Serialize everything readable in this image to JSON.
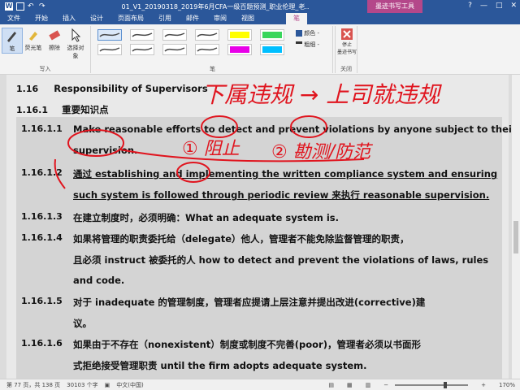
{
  "titlebar": {
    "doc_title": "01_V1_20190318_2019年6月CFA一级百题预测_职业伦理_老..",
    "context_tab": "墨迹书写工具"
  },
  "tabs": [
    "文件",
    "开始",
    "插入",
    "设计",
    "页面布局",
    "引用",
    "邮件",
    "审阅",
    "视图",
    "笔"
  ],
  "ribbon": {
    "tools": [
      "笔",
      "荧光笔",
      "擦除",
      "选择对象"
    ],
    "group_write": "写入",
    "group_pens": "笔",
    "color_label": "颜色 -",
    "thickness_label": "粗细 -",
    "stop_label": "停止\n墨迹书写",
    "group_close": "关闭",
    "pen_colors": [
      "#4a4a4a",
      "#4a4a4a",
      "#4a4a4a",
      "#4a4a4a",
      "#ffff00",
      "#39d65c",
      "#4a4a4a",
      "#4a4a4a",
      "#4a4a4a",
      "#4a4a4a",
      "#e800e8",
      "#00bfff"
    ]
  },
  "document": {
    "heading": {
      "num": "1.16",
      "text": "Responsibility of Supervisors"
    },
    "subheading": {
      "num": "1.16.1",
      "text": "重要知识点"
    },
    "items": [
      {
        "num": "1.16.1.1",
        "lines": [
          "Make reasonable efforts to detect and prevent violations by anyone subject to their",
          "supervision."
        ]
      },
      {
        "num": "1.16.1.2",
        "lines": [
          "通过 establishing and implementing the written compliance system and ensuring",
          "such system is followed through periodic review 来执行 reasonable supervision."
        ]
      },
      {
        "num": "1.16.1.3",
        "lines": [
          "在建立制度时，必须明确：What an adequate system is."
        ]
      },
      {
        "num": "1.16.1.4",
        "lines": [
          "如果将管理的职责委托给（delegate）他人，管理者不能免除监督管理的职责，",
          "且必须 instruct  被委托的人 how to detect and prevent the violations of laws, rules",
          "and code."
        ]
      },
      {
        "num": "1.16.1.5",
        "lines": [
          "对于  inadequate  的管理制度，管理者应提请上层注意并提出改进(corrective)建",
          "议。"
        ]
      },
      {
        "num": "1.16.1.6",
        "lines": [
          "如果由于不存在（nonexistent）制度或制度不完善(poor)，管理者必须以书面形",
          "式拒绝接受管理职责   until the firm adopts adequate system."
        ]
      }
    ],
    "ink_annotations": [
      "下属违规 → 上司就违规",
      "① 阻止",
      "② 勘测/防范"
    ]
  },
  "status": {
    "page": "第 77 页，共 138 页",
    "words": "30103 个字",
    "lang": "中文(中国)",
    "zoom": "170%"
  }
}
